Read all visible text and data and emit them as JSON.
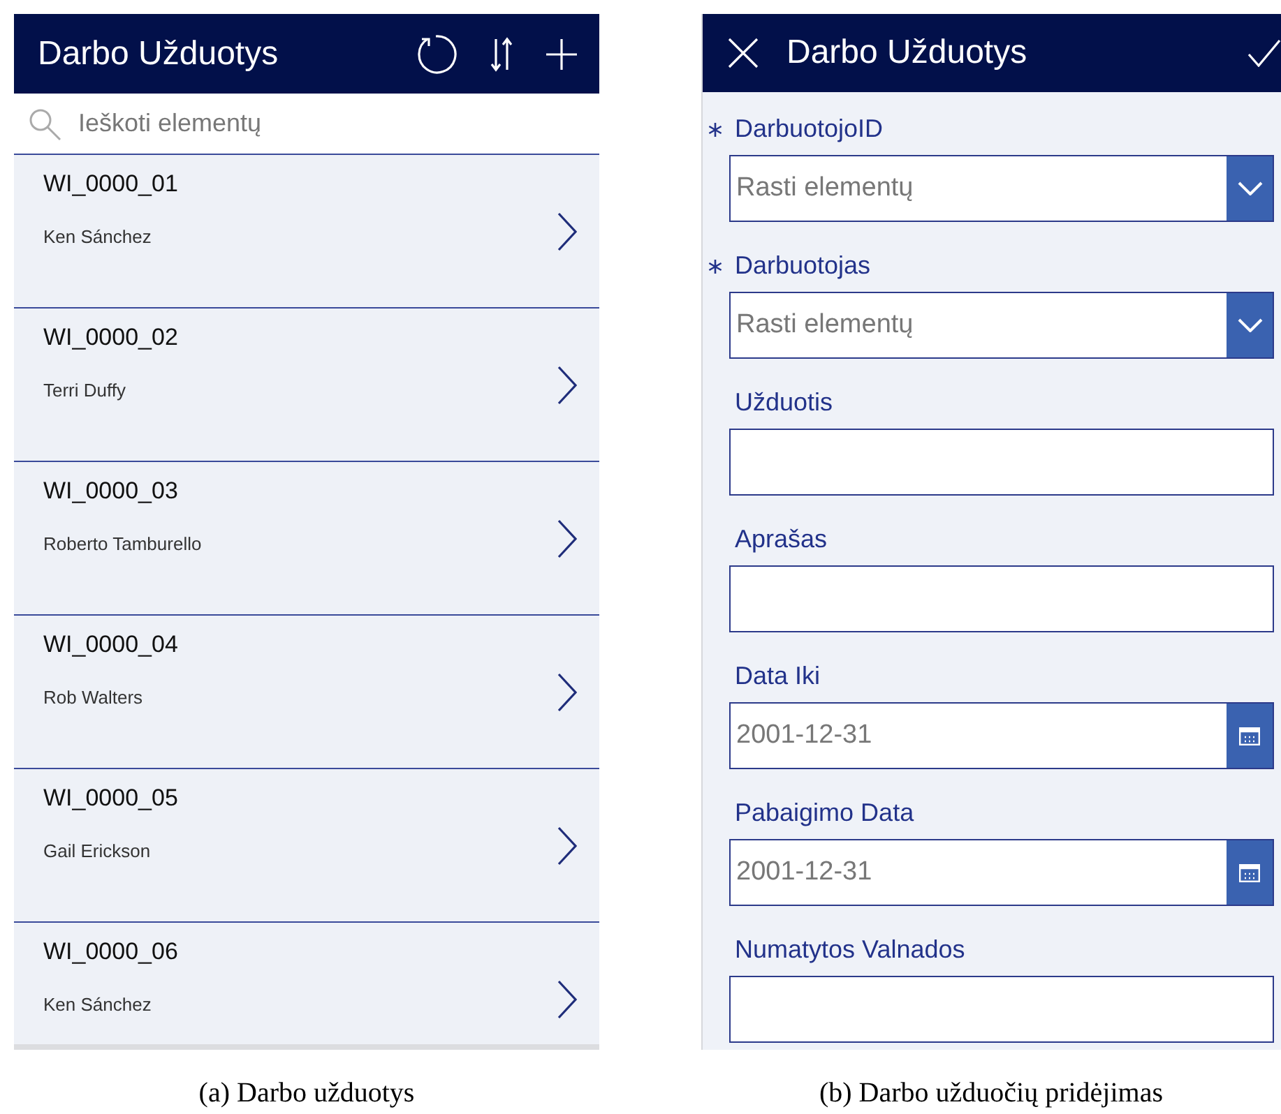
{
  "panels": [
    {
      "kind": "list",
      "header": {
        "title": "Darbo Užduotys"
      },
      "search": {
        "placeholder": "Ieškoti elementų"
      },
      "items": [
        {
          "title": "WI_0000_01",
          "subtitle": "Ken Sánchez"
        },
        {
          "title": "WI_0000_02",
          "subtitle": "Terri Duffy"
        },
        {
          "title": "WI_0000_03",
          "subtitle": "Roberto Tamburello"
        },
        {
          "title": "WI_0000_04",
          "subtitle": "Rob Walters"
        },
        {
          "title": "WI_0000_05",
          "subtitle": "Gail Erickson"
        },
        {
          "title": "WI_0000_06",
          "subtitle": "Ken Sánchez"
        }
      ],
      "caption": "(a) Darbo užduotys"
    },
    {
      "kind": "form",
      "header": {
        "title": "Darbo Užduotys"
      },
      "fields": [
        {
          "kind": "dropdown",
          "required": true,
          "label": "DarbuotojoID",
          "placeholder": "Rasti elementų"
        },
        {
          "kind": "dropdown",
          "required": true,
          "label": "Darbuotojas",
          "placeholder": "Rasti elementų"
        },
        {
          "kind": "text",
          "required": false,
          "label": "Užduotis"
        },
        {
          "kind": "text",
          "required": false,
          "label": "Aprašas"
        },
        {
          "kind": "date",
          "required": false,
          "label": "Data Iki",
          "value": "2001-12-31"
        },
        {
          "kind": "date",
          "required": false,
          "label": "Pabaigimo Data",
          "value": "2001-12-31"
        },
        {
          "kind": "text",
          "required": false,
          "label": "Numatytos Valnados"
        }
      ],
      "caption": "(b) Darbo užduočių pridėjimas"
    }
  ]
}
